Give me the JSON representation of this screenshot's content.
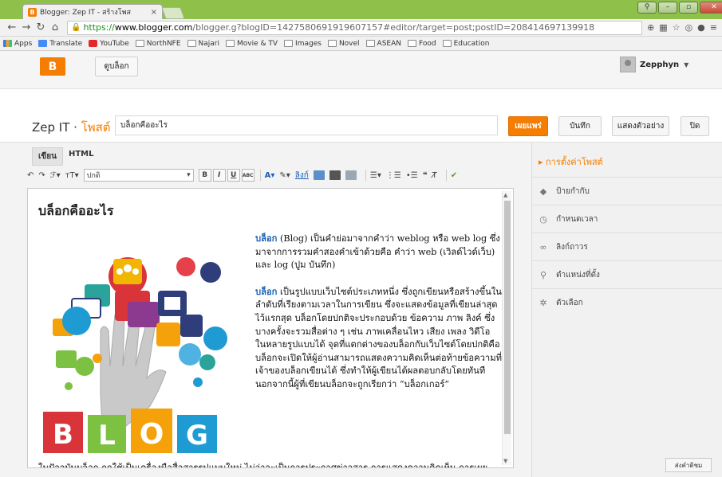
{
  "browser": {
    "tab_title": "Blogger: Zep IT - สร้างโพส",
    "tab_close": "×",
    "url_https": "https://",
    "url_host": "www.blogger.com",
    "url_path": "/blogger.g?blogID=1427580691919607157#editor/target=post;postID=20841469713991​8",
    "bookmarks": [
      "Apps",
      "Translate",
      "YouTube",
      "NorthNFE",
      "Najari",
      "Movie & TV",
      "Images",
      "Novel",
      "ASEAN",
      "Food",
      "Education"
    ]
  },
  "header": {
    "logo": "B",
    "view_blog": "ดูบล็อก",
    "user_name": "Zepphyn"
  },
  "titlebar": {
    "blog_name": "Zep IT",
    "separator": " · ",
    "section": "โพสต์",
    "post_title": "บล็อกคืออะไร",
    "publish": "เผยแพร่",
    "save": "บันทึก",
    "preview": "แสดงตัวอย่าง",
    "close": "ปิด"
  },
  "editor": {
    "tab_compose": "เขียน",
    "tab_html": "HTML",
    "font_size_select": "ปกติ",
    "heading": "บล็อกคืออะไร",
    "para1_kw": "บล็อก",
    "para1": " (Blog) เป็นคำย่อมาจากคำว่า weblog  หรือ web log ซึ่งมาจากการรวมคำสองคำเข้าด้วยคือ คำว่า web (เวิลด์ไวด์เว็บ) และ log (ปูม บันทึก)",
    "para2_kw": "บล็อก",
    "para2": " เป็นรูปแบบเว็บไซต์ประเภทหนึ่ง ซึ่งถูกเขียนหรือสร้างขึ้นในลำดับที่เรียงตามเวลาในการเขียน ซึ่งจะแสดงข้อมูลที่เขียนล่าสุดไว้แรกสุด บล็อกโดยปกติจะประกอบด้วย ข้อความ ภาพ ลิงค์ ซึ่งบางครั้งจะรวมสื่อต่าง ๆ เช่น ภาพเคลื่อนไหว เสียง เพลง วิดีโอ ในหลายรูปแบบได้ จุดที่แตกต่างของบล็อกกับเว็บไซต์โดยปกติคือ บล็อกจะเปิดให้ผู้อ่านสามารถแสดงความคิดเห็นต่อท้ายข้อความที่เจ้าของบล็อกเขียนได้ ซึ่งทำให้ผู้เขียนได้ผลตอบกลับโดยทันที นอกจากนี้ผู้ที่เขียนบล็อกจะถูกเรียกว่า “บล็อกเกอร์”",
    "para3": "ในปัจจุบันบล็อก ถูกใช้เป็นเครื่องมือสื่อสารรูปแบบใหม่ ไม่ว่าจะเป็นการประกาศข่าวสาร การแสดงความคิดเห็น การเผยแพร่ความรู้ การเผยแพร่ผลงาน ฯลฯ",
    "image_letters": [
      "B",
      "L",
      "O",
      "G"
    ]
  },
  "side_panel": {
    "title": "▸ การตั้งค่าโพสต์",
    "items": [
      "ป้ายกำกับ",
      "กำหนดเวลา",
      "ลิงก์ถาวร",
      "ตำแหน่งที่ตั้ง",
      "ตัวเลือก"
    ]
  },
  "feedback": "ส่งคำติชม",
  "colors": {
    "accent": "#f57d00",
    "chrome": "#8fc04a",
    "link": "#1a5fb4"
  }
}
